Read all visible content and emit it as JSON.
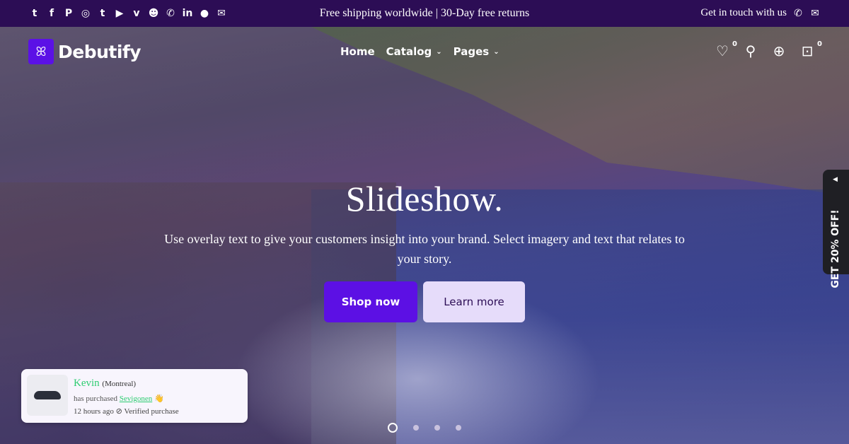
{
  "topbar": {
    "social_icons": [
      "twitter-icon",
      "facebook-icon",
      "pinterest-icon",
      "instagram-icon",
      "tumblr-icon",
      "youtube-icon",
      "vimeo-icon",
      "snapchat-icon",
      "whatsapp-icon",
      "linkedin-icon",
      "reddit-icon",
      "messenger-icon"
    ],
    "announcement": "Free shipping worldwide | 30-Day free returns",
    "contact_label": "Get in touch with us"
  },
  "header": {
    "logo_text": "Debutify",
    "nav": [
      {
        "label": "Home",
        "dropdown": false
      },
      {
        "label": "Catalog",
        "dropdown": true
      },
      {
        "label": "Pages",
        "dropdown": true
      }
    ],
    "wishlist_count": "0",
    "cart_count": "0"
  },
  "hero": {
    "title": "Slideshow.",
    "text": "Use overlay text to give your customers insight into your brand. Select imagery and text that relates to your story.",
    "primary_button": "Shop now",
    "secondary_button": "Learn more",
    "slides": 4,
    "active_slide": 1
  },
  "popup": {
    "name": "Kevin",
    "location": "(Montreal)",
    "prefix": "has purchased",
    "product": "Sevigonen",
    "time": "12 hours ago",
    "verified": "Verified purchase"
  },
  "side_tab": {
    "label": "GET 20% OFF!"
  },
  "colors": {
    "brand": "#5c10e4",
    "topbar": "#2c0d55",
    "accent_green": "#2ecc71"
  }
}
